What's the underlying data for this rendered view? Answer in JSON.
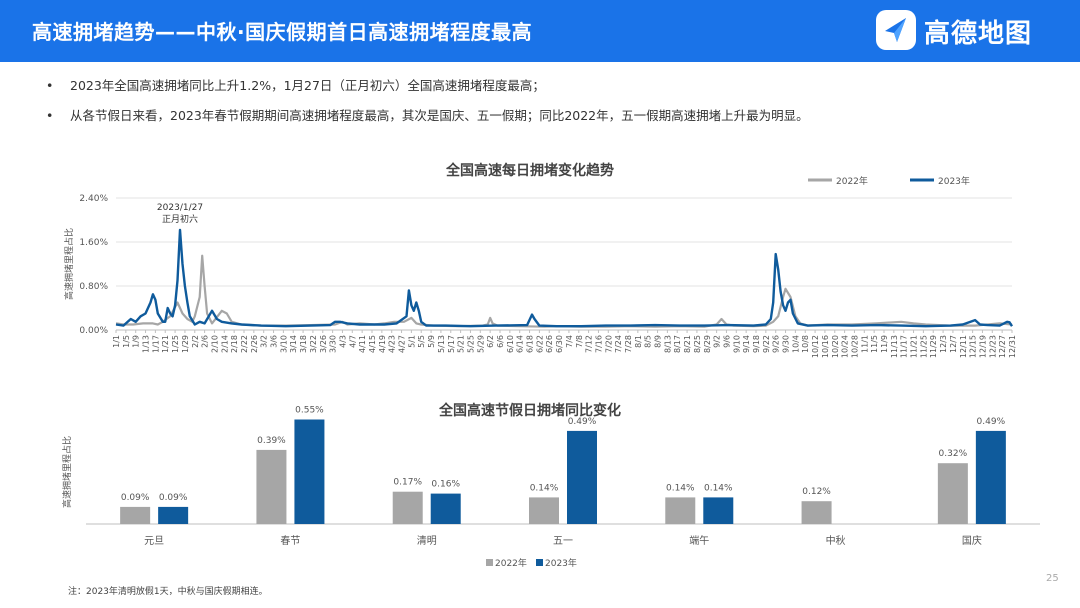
{
  "header": {
    "title": "高速拥堵趋势——中秋·国庆假期首日高速拥堵程度最高",
    "logo_text": "高德地图"
  },
  "bullets": [
    "2023年全国高速拥堵同比上升1.2%，1月27日（正月初六）全国高速拥堵程度最高；",
    "从各节假日来看，2023年春节假期期间高速拥堵程度最高，其次是国庆、五一假期；同比2022年，五一假期高速拥堵上升最为明显。"
  ],
  "bullet_marker": "•",
  "colors": {
    "header_bg": "#1a73e8",
    "series_2022": "#a6a6a6",
    "series_2023": "#0f5b9c"
  },
  "chart_data": [
    {
      "type": "line",
      "title": "全国高速每日拥堵变化趋势",
      "ylabel": "高速拥堵里程占比",
      "ylim": [
        0,
        2.4
      ],
      "yticks": [
        0,
        0.8,
        1.6,
        2.4
      ],
      "ytick_labels": [
        "0.00%",
        "0.80%",
        "1.60%",
        "2.40%"
      ],
      "xlabels": [
        "1/1",
        "1/5",
        "1/9",
        "1/13",
        "1/17",
        "1/21",
        "1/25",
        "1/29",
        "2/2",
        "2/6",
        "2/10",
        "2/14",
        "2/18",
        "2/22",
        "2/26",
        "3/2",
        "3/6",
        "3/10",
        "3/14",
        "3/18",
        "3/22",
        "3/26",
        "3/30",
        "4/3",
        "4/7",
        "4/11",
        "4/15",
        "4/19",
        "4/23",
        "4/27",
        "5/1",
        "5/5",
        "5/9",
        "5/13",
        "5/17",
        "5/21",
        "5/25",
        "5/29",
        "6/2",
        "6/6",
        "6/10",
        "6/14",
        "6/18",
        "6/22",
        "6/26",
        "6/30",
        "7/4",
        "7/8",
        "7/12",
        "7/16",
        "7/20",
        "7/24",
        "7/28",
        "8/1",
        "8/5",
        "8/9",
        "8/13",
        "8/17",
        "8/21",
        "8/25",
        "8/29",
        "9/2",
        "9/6",
        "9/10",
        "9/14",
        "9/18",
        "9/22",
        "9/26",
        "9/30",
        "10/4",
        "10/8",
        "10/12",
        "10/16",
        "10/20",
        "10/24",
        "10/28",
        "11/1",
        "11/5",
        "11/9",
        "11/13",
        "11/17",
        "11/21",
        "11/25",
        "11/29",
        "12/3",
        "12/7",
        "12/11",
        "12/15",
        "12/19",
        "12/23",
        "12/27",
        "12/31"
      ],
      "legend_position": "top-right",
      "annotation": {
        "line1": "2023/1/27",
        "line2": "正月初六",
        "x_day": 27,
        "y": 1.82
      },
      "series": [
        {
          "name": "2022年",
          "points": [
            [
              1,
              0.12
            ],
            [
              4,
              0.1
            ],
            [
              8,
              0.1
            ],
            [
              12,
              0.12
            ],
            [
              16,
              0.12
            ],
            [
              18,
              0.1
            ],
            [
              20,
              0.15
            ],
            [
              23,
              0.25
            ],
            [
              26,
              0.5
            ],
            [
              28,
              0.3
            ],
            [
              30,
              0.2
            ],
            [
              32,
              0.15
            ],
            [
              33,
              0.25
            ],
            [
              35,
              0.6
            ],
            [
              36,
              1.35
            ],
            [
              37,
              0.8
            ],
            [
              38,
              0.3
            ],
            [
              40,
              0.12
            ],
            [
              44,
              0.35
            ],
            [
              46,
              0.3
            ],
            [
              48,
              0.15
            ],
            [
              52,
              0.1
            ],
            [
              60,
              0.08
            ],
            [
              70,
              0.08
            ],
            [
              80,
              0.09
            ],
            [
              90,
              0.1
            ],
            [
              93,
              0.15
            ],
            [
              95,
              0.1
            ],
            [
              100,
              0.12
            ],
            [
              106,
              0.1
            ],
            [
              110,
              0.12
            ],
            [
              114,
              0.15
            ],
            [
              118,
              0.15
            ],
            [
              121,
              0.22
            ],
            [
              123,
              0.12
            ],
            [
              125,
              0.1
            ],
            [
              130,
              0.08
            ],
            [
              140,
              0.07
            ],
            [
              150,
              0.08
            ],
            [
              152,
              0.1
            ],
            [
              153,
              0.22
            ],
            [
              154,
              0.12
            ],
            [
              156,
              0.08
            ],
            [
              165,
              0.07
            ],
            [
              175,
              0.06
            ],
            [
              180,
              0.07
            ],
            [
              190,
              0.06
            ],
            [
              200,
              0.06
            ],
            [
              210,
              0.07
            ],
            [
              220,
              0.06
            ],
            [
              230,
              0.07
            ],
            [
              240,
              0.06
            ],
            [
              245,
              0.1
            ],
            [
              247,
              0.2
            ],
            [
              249,
              0.1
            ],
            [
              252,
              0.08
            ],
            [
              260,
              0.07
            ],
            [
              265,
              0.08
            ],
            [
              268,
              0.15
            ],
            [
              270,
              0.25
            ],
            [
              272,
              0.6
            ],
            [
              273,
              0.75
            ],
            [
              275,
              0.6
            ],
            [
              277,
              0.25
            ],
            [
              279,
              0.12
            ],
            [
              282,
              0.08
            ],
            [
              290,
              0.1
            ],
            [
              300,
              0.1
            ],
            [
              310,
              0.12
            ],
            [
              320,
              0.15
            ],
            [
              325,
              0.12
            ],
            [
              330,
              0.1
            ],
            [
              340,
              0.08
            ],
            [
              350,
              0.08
            ],
            [
              355,
              0.1
            ],
            [
              360,
              0.12
            ],
            [
              365,
              0.1
            ]
          ]
        },
        {
          "name": "2023年",
          "points": [
            [
              1,
              0.1
            ],
            [
              4,
              0.08
            ],
            [
              7,
              0.2
            ],
            [
              9,
              0.15
            ],
            [
              11,
              0.25
            ],
            [
              13,
              0.3
            ],
            [
              15,
              0.5
            ],
            [
              16,
              0.65
            ],
            [
              17,
              0.55
            ],
            [
              18,
              0.3
            ],
            [
              20,
              0.15
            ],
            [
              21,
              0.15
            ],
            [
              22,
              0.4
            ],
            [
              23,
              0.3
            ],
            [
              24,
              0.25
            ],
            [
              25,
              0.45
            ],
            [
              26,
              0.9
            ],
            [
              27,
              1.82
            ],
            [
              28,
              1.2
            ],
            [
              29,
              0.8
            ],
            [
              30,
              0.5
            ],
            [
              31,
              0.25
            ],
            [
              33,
              0.1
            ],
            [
              35,
              0.15
            ],
            [
              37,
              0.12
            ],
            [
              40,
              0.35
            ],
            [
              42,
              0.2
            ],
            [
              44,
              0.15
            ],
            [
              48,
              0.12
            ],
            [
              52,
              0.1
            ],
            [
              60,
              0.08
            ],
            [
              70,
              0.07
            ],
            [
              80,
              0.08
            ],
            [
              88,
              0.09
            ],
            [
              90,
              0.15
            ],
            [
              92,
              0.15
            ],
            [
              95,
              0.12
            ],
            [
              100,
              0.1
            ],
            [
              110,
              0.1
            ],
            [
              115,
              0.12
            ],
            [
              119,
              0.25
            ],
            [
              120,
              0.72
            ],
            [
              121,
              0.45
            ],
            [
              122,
              0.35
            ],
            [
              123,
              0.5
            ],
            [
              124,
              0.35
            ],
            [
              125,
              0.15
            ],
            [
              127,
              0.08
            ],
            [
              135,
              0.08
            ],
            [
              145,
              0.07
            ],
            [
              155,
              0.08
            ],
            [
              168,
              0.09
            ],
            [
              170,
              0.28
            ],
            [
              171,
              0.2
            ],
            [
              173,
              0.08
            ],
            [
              180,
              0.07
            ],
            [
              190,
              0.07
            ],
            [
              200,
              0.08
            ],
            [
              210,
              0.08
            ],
            [
              220,
              0.09
            ],
            [
              230,
              0.08
            ],
            [
              240,
              0.08
            ],
            [
              250,
              0.09
            ],
            [
              260,
              0.08
            ],
            [
              265,
              0.1
            ],
            [
              267,
              0.2
            ],
            [
              268,
              0.5
            ],
            [
              269,
              1.38
            ],
            [
              270,
              1.1
            ],
            [
              271,
              0.7
            ],
            [
              272,
              0.45
            ],
            [
              273,
              0.35
            ],
            [
              274,
              0.5
            ],
            [
              275,
              0.55
            ],
            [
              276,
              0.3
            ],
            [
              278,
              0.12
            ],
            [
              282,
              0.08
            ],
            [
              290,
              0.09
            ],
            [
              300,
              0.08
            ],
            [
              310,
              0.09
            ],
            [
              320,
              0.08
            ],
            [
              330,
              0.07
            ],
            [
              340,
              0.08
            ],
            [
              345,
              0.1
            ],
            [
              350,
              0.18
            ],
            [
              352,
              0.1
            ],
            [
              355,
              0.09
            ],
            [
              360,
              0.08
            ],
            [
              363,
              0.15
            ],
            [
              364,
              0.14
            ],
            [
              365,
              0.07
            ]
          ]
        }
      ]
    },
    {
      "type": "bar",
      "title": "全国高速节假日拥堵同比变化",
      "ylabel": "高速拥堵里程占比",
      "categories": [
        "元旦",
        "春节",
        "清明",
        "五一",
        "端午",
        "中秋",
        "国庆"
      ],
      "legend_position": "bottom",
      "series": [
        {
          "name": "2022年",
          "values": [
            0.09,
            0.39,
            0.17,
            0.14,
            0.14,
            0.12,
            0.32
          ],
          "labels": [
            "0.09%",
            "0.39%",
            "0.17%",
            "0.14%",
            "0.14%",
            "0.12%",
            "0.32%"
          ]
        },
        {
          "name": "2023年",
          "values": [
            0.09,
            0.55,
            0.16,
            0.49,
            0.14,
            null,
            0.49
          ],
          "labels": [
            "0.09%",
            "0.55%",
            "0.16%",
            "0.49%",
            "0.14%",
            "",
            "0.49%"
          ]
        }
      ]
    }
  ],
  "footnote": "注：2023年清明放假1天，中秋与国庆假期相连。",
  "page_number": "25"
}
